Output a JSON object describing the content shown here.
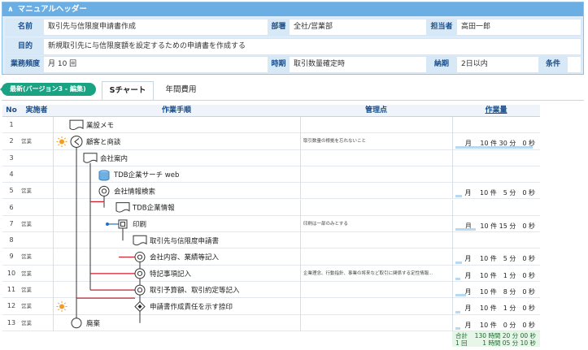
{
  "header": {
    "title": "マニュアルヘッダー",
    "name_label": "名前",
    "name_value": "取引先与信限度申請書作成",
    "dept_label": "部署",
    "dept_value": "全社/営業部",
    "owner_label": "担当者",
    "owner_value": "高田一郎",
    "purpose_label": "目的",
    "purpose_value": "新規取引先に与信限度額を設定するための申請書を作成する",
    "freq_label": "業務頻度",
    "freq_value": "月 10 回",
    "timing_label": "時期",
    "timing_value": "取引数量確定時",
    "deadline_label": "納期",
    "deadline_value": "2日以内",
    "condition_label": "条件"
  },
  "tabs": {
    "version_badge": "最新(バージョン3 - 編集)",
    "schart": "Sチャート",
    "annual": "年間費用"
  },
  "table": {
    "headers": {
      "no": "No",
      "executor": "実施者",
      "procedure": "作業手順",
      "management": "管理点",
      "work_time": "作業量"
    },
    "rows": [
      {
        "no": "1",
        "executor": "",
        "step": "業設メモ",
        "note": "",
        "time": ""
      },
      {
        "no": "2",
        "executor": "営業",
        "step": "顧客と商談",
        "note": "取引数量の根拠を忘れないこと",
        "time": "月　 10 件 30 分　0 秒",
        "bar": 0.95
      },
      {
        "no": "3",
        "executor": "",
        "step": "会社案内",
        "note": "",
        "time": ""
      },
      {
        "no": "4",
        "executor": "",
        "step": "TDB企業サーチ web",
        "note": "",
        "time": ""
      },
      {
        "no": "5",
        "executor": "営業",
        "step": "会社情報検索",
        "note": "",
        "time": "月　 10 件　5 分　0 秒",
        "bar": 0.08
      },
      {
        "no": "6",
        "executor": "",
        "step": "TDB企業情報",
        "note": "",
        "time": ""
      },
      {
        "no": "7",
        "executor": "営業",
        "step": "印刷",
        "note": "印刷は一部のみとする",
        "time": "月　 10 件 15 分　0 秒",
        "bar": 0.25
      },
      {
        "no": "8",
        "executor": "",
        "step": "取引先与信限度申請書",
        "note": "",
        "time": ""
      },
      {
        "no": "9",
        "executor": "営業",
        "step": "会社内容、業績等記入",
        "note": "",
        "time": "月　 10 件　5 分　0 秒",
        "bar": 0.08
      },
      {
        "no": "10",
        "executor": "営業",
        "step": "特記事項記入",
        "note": "企業理念、行動指針、事業の将来など取引に関係する定性情報...",
        "time": "月　 10 件　1 分　0 秒",
        "bar": 0.02
      },
      {
        "no": "11",
        "executor": "営業",
        "step": "取引予算額、取引約定等記入",
        "note": "",
        "time": "月　 10 件　8 分　0 秒",
        "bar": 0.13
      },
      {
        "no": "12",
        "executor": "営業",
        "step": "申請書作成責任を示す捺印",
        "note": "",
        "time": "月　 10 件　1 分　0 秒",
        "bar": 0.02
      },
      {
        "no": "13",
        "executor": "営業",
        "step": "廃棄",
        "note": "",
        "time": "月　 10 件　0 分　0 秒",
        "bar": 0.0
      }
    ],
    "total_label": "合計",
    "total_value": "130 時間 20 分 00 秒",
    "per_label": "1 回",
    "per_value": "1 時間 05 分 10 秒"
  },
  "colors": {
    "header_bar": "#6aaee3",
    "badge": "#1aa382",
    "red_line": "#d21c2c",
    "blue_line": "#1f6fc6"
  }
}
